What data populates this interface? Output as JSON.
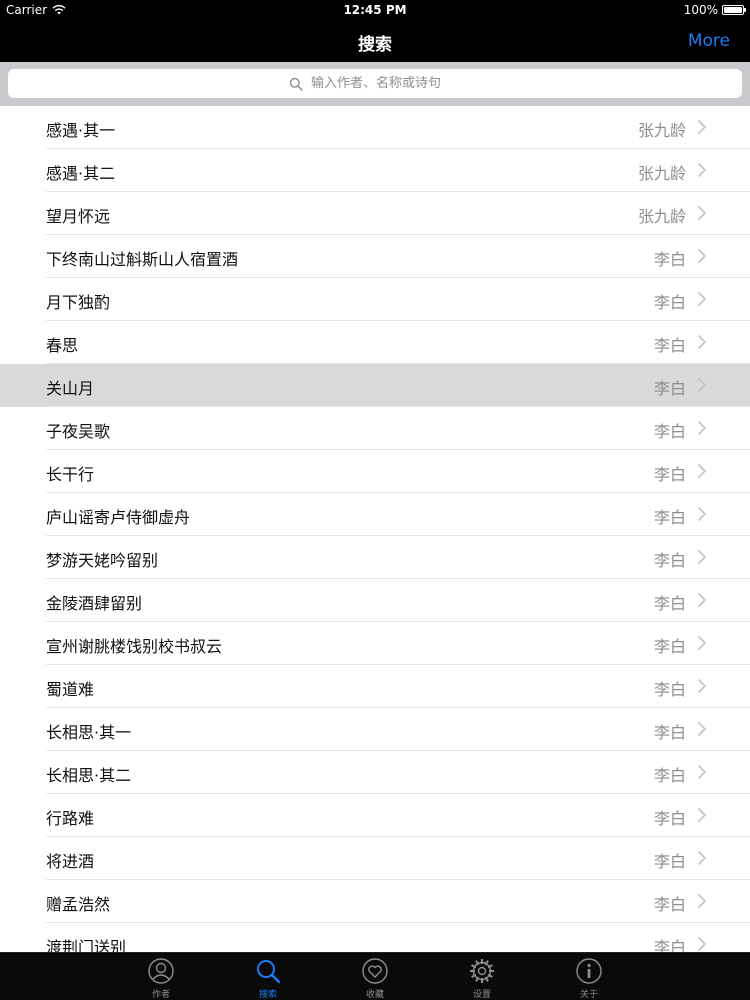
{
  "status_bar": {
    "carrier": "Carrier",
    "time": "12:45 PM",
    "battery": "100%",
    "battery_level": 1.0
  },
  "nav": {
    "title": "搜索",
    "more_label": "More"
  },
  "search": {
    "placeholder": "输入作者、名称或诗句"
  },
  "poems": [
    {
      "title": "感遇·其一",
      "author": "张九龄"
    },
    {
      "title": "感遇·其二",
      "author": "张九龄"
    },
    {
      "title": "望月怀远",
      "author": "张九龄"
    },
    {
      "title": "下终南山过斛斯山人宿置酒",
      "author": "李白"
    },
    {
      "title": "月下独酌",
      "author": "李白"
    },
    {
      "title": "春思",
      "author": "李白"
    },
    {
      "title": "关山月",
      "author": "李白"
    },
    {
      "title": "子夜吴歌",
      "author": "李白"
    },
    {
      "title": "长干行",
      "author": "李白"
    },
    {
      "title": "庐山谣寄卢侍御虚舟",
      "author": "李白"
    },
    {
      "title": "梦游天姥吟留别",
      "author": "李白"
    },
    {
      "title": "金陵酒肆留别",
      "author": "李白"
    },
    {
      "title": "宣州谢朓楼饯别校书叔云",
      "author": "李白"
    },
    {
      "title": "蜀道难",
      "author": "李白"
    },
    {
      "title": "长相思·其一",
      "author": "李白"
    },
    {
      "title": "长相思·其二",
      "author": "李白"
    },
    {
      "title": "行路难",
      "author": "李白"
    },
    {
      "title": "将进酒",
      "author": "李白"
    },
    {
      "title": "赠孟浩然",
      "author": "李白"
    },
    {
      "title": "渡荆门送别",
      "author": "李白"
    }
  ],
  "selected_index": 6,
  "tabs": [
    {
      "label": "作者",
      "icon": "person-icon"
    },
    {
      "label": "搜索",
      "icon": "search-icon"
    },
    {
      "label": "收藏",
      "icon": "heart-icon"
    },
    {
      "label": "设置",
      "icon": "gear-icon"
    },
    {
      "label": "关于",
      "icon": "info-icon"
    }
  ],
  "active_tab": 1,
  "colors": {
    "accent": "#1a7cf2",
    "inactive": "#8e8e93",
    "selected_row": "#d9d9d9"
  }
}
